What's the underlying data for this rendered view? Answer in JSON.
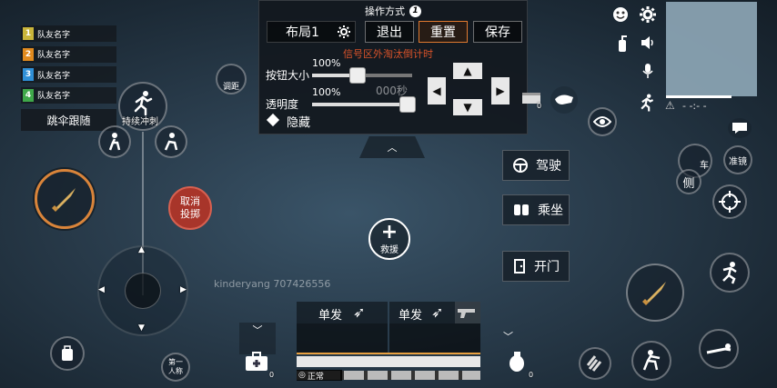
{
  "team": {
    "members": [
      {
        "num": "1",
        "name": "队友名字",
        "color": "#c9b53a"
      },
      {
        "num": "2",
        "name": "队友名字",
        "color": "#e08a1e"
      },
      {
        "num": "3",
        "name": "队友名字",
        "color": "#2f8fd6"
      },
      {
        "num": "4",
        "name": "队友名字",
        "color": "#3fa84a"
      }
    ],
    "follow_label": "跳伞跟随"
  },
  "left": {
    "sprint_label": "持续冲刺",
    "cancel_throw_label": "取消\n投掷",
    "view_label": "第一\n人称",
    "adjust_label": "调距"
  },
  "panel": {
    "title": "操作方式",
    "badge": "1",
    "layout_name": "布局1",
    "exit_label": "退出",
    "reset_label": "重置",
    "save_label": "保存",
    "button_size_label": "按钮大小",
    "button_size_value": "100%",
    "button_size_fraction": 0.45,
    "opacity_label": "透明度",
    "opacity_value": "100%",
    "opacity_fraction": 1.0,
    "hide_label": "隐藏",
    "overlay_text": "信号区外淘汰倒计时",
    "overlay_timer": "000秒"
  },
  "center": {
    "rescue_label": "救援",
    "watermark": "kinderyang 707426556"
  },
  "vehicle": {
    "drive_label": "驾驶",
    "ride_label": "乘坐",
    "open_label": "开门"
  },
  "weapons": {
    "slot1_mode": "单发",
    "slot2_mode": "单发",
    "stance": "正常",
    "medkit_count": "0",
    "grenade_count": "0",
    "item_count": "0"
  },
  "right": {
    "get_in_label": "车",
    "lean_label": "侧",
    "scope_label": "准镜",
    "signal_text": "- -:- -"
  }
}
